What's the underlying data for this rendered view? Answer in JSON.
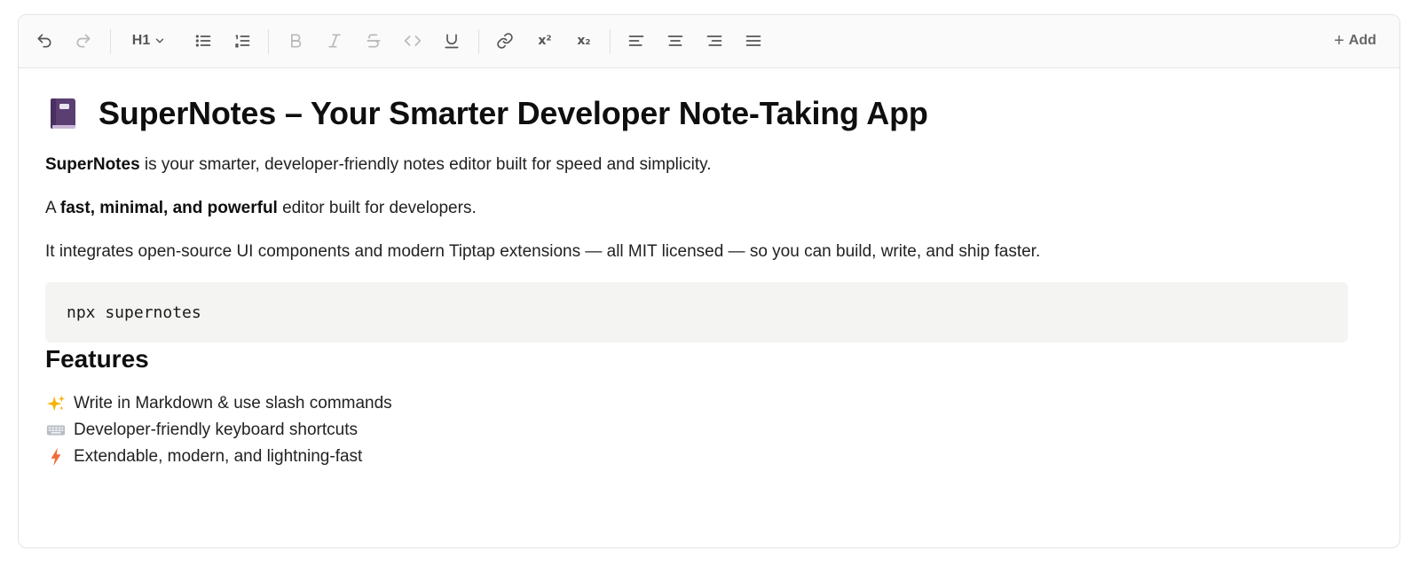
{
  "toolbar": {
    "undo_icon": "undo-icon",
    "redo_icon": "redo-icon",
    "heading_label": "H1",
    "bullet_list_icon": "bullet-list-icon",
    "ordered_list_icon": "ordered-list-icon",
    "bold_icon": "bold-icon",
    "italic_icon": "italic-icon",
    "strike_icon": "strikethrough-icon",
    "code_icon": "code-icon",
    "underline_icon": "underline-icon",
    "link_icon": "link-icon",
    "superscript_label": "x²",
    "subscript_label": "x₂",
    "align_icons": [
      "align-left-icon",
      "align-center-icon",
      "align-right-icon",
      "align-justify-icon"
    ],
    "add_label": "Add"
  },
  "document": {
    "title_icon": "notebook-icon",
    "title": "SuperNotes – Your Smarter Developer Note-Taking App",
    "intro": {
      "bold": "SuperNotes",
      "rest": " is your smarter, developer-friendly notes editor built for speed and simplicity."
    },
    "tagline": {
      "prefix": "A ",
      "bold": "fast, minimal, and powerful",
      "rest": " editor built for developers."
    },
    "description": "It integrates open-source UI components and modern Tiptap extensions — all MIT licensed — so you can build, write, and ship faster.",
    "code": "npx supernotes",
    "features_heading": "Features",
    "features": [
      {
        "icon": "sparkles-icon",
        "text": "Write in Markdown & use slash commands"
      },
      {
        "icon": "keyboard-icon",
        "text": "Developer-friendly keyboard shortcuts"
      },
      {
        "icon": "lightning-icon",
        "text": "Extendable, modern, and lightning-fast"
      }
    ]
  },
  "colors": {
    "toolbar_bg": "#fafafa",
    "border": "#e3e3e3",
    "code_bg": "#f4f4f2",
    "icon": "#555555",
    "icon_disabled": "#b8b8b8",
    "book_purple": "#5b3f73",
    "lightning_orange": "#f26b3a"
  }
}
